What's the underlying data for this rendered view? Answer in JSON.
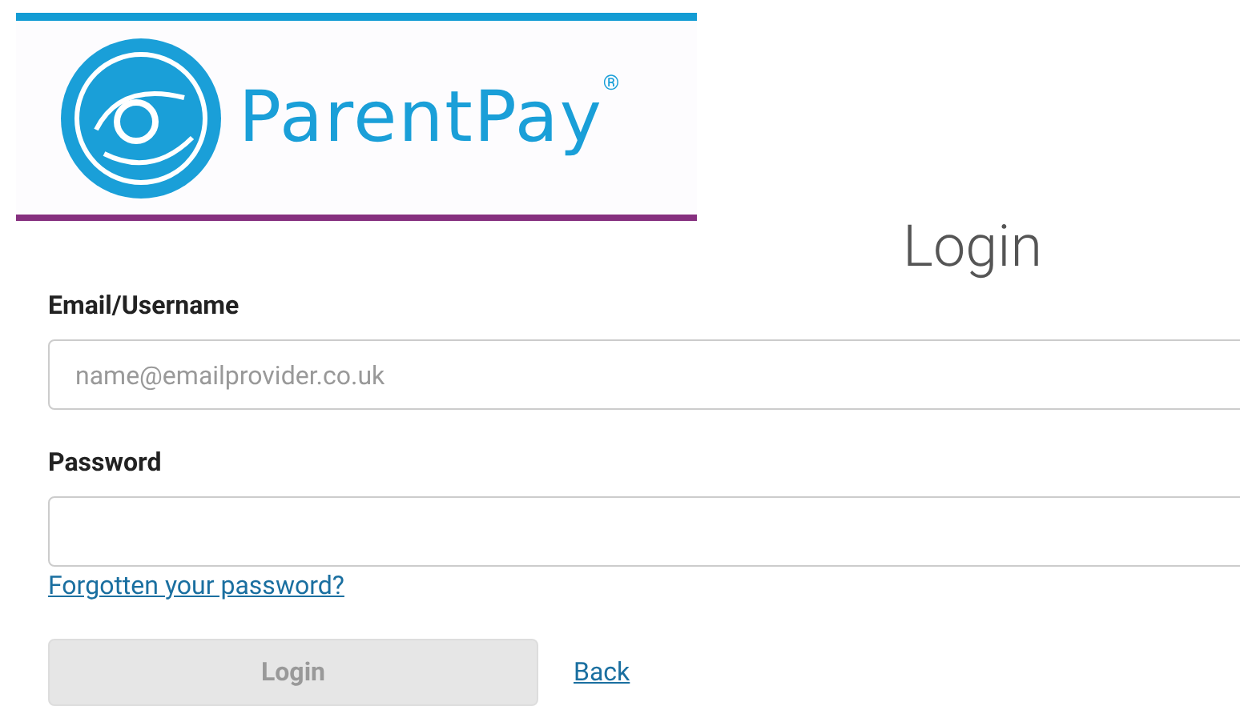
{
  "logo": {
    "name": "ParentPay",
    "mark": "®"
  },
  "title": "Login",
  "fields": [
    {
      "label": "Email/Username",
      "placeholder": "name@emailprovider.co.uk"
    },
    {
      "label": "Password"
    }
  ],
  "forgot_link": "Forgotten your password?",
  "login_button": {
    "label": "Login",
    "disabled": true
  },
  "back_link": "Back"
}
